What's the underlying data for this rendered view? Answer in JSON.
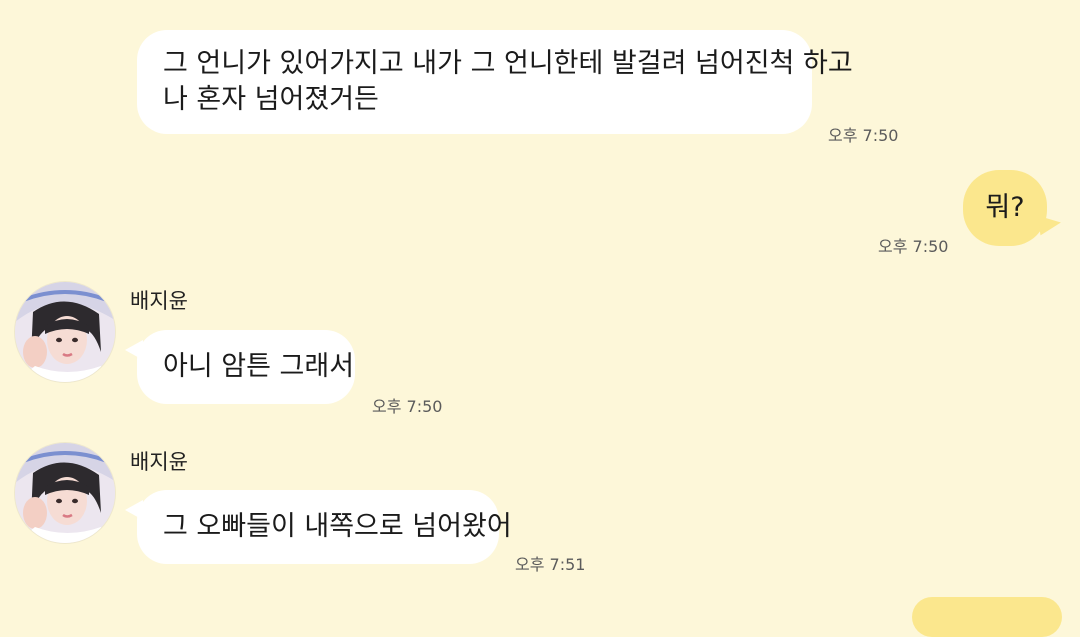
{
  "theme": {
    "background": "#fdf7d9",
    "incoming_bubble": "#ffffff",
    "outgoing_bubble": "#fbe78d"
  },
  "messages": [
    {
      "direction": "incoming",
      "lines": [
        "그 언니가 있어가지고 내가 그 언니한테 발걸려 넘어진척 하고",
        "나 혼자 넘어졌거든"
      ],
      "time": "오후 7:50"
    },
    {
      "direction": "outgoing",
      "text": "뭐?",
      "time": "오후 7:50"
    },
    {
      "direction": "incoming",
      "sender": "배지윤",
      "avatar_icon": "profile-photo-avatar",
      "text": "아니 암튼 그래서",
      "time": "오후 7:50"
    },
    {
      "direction": "incoming",
      "sender": "배지윤",
      "avatar_icon": "profile-photo-avatar",
      "text": "그 오빠들이 내쪽으로 넘어왔어",
      "time": "오후 7:51"
    }
  ]
}
